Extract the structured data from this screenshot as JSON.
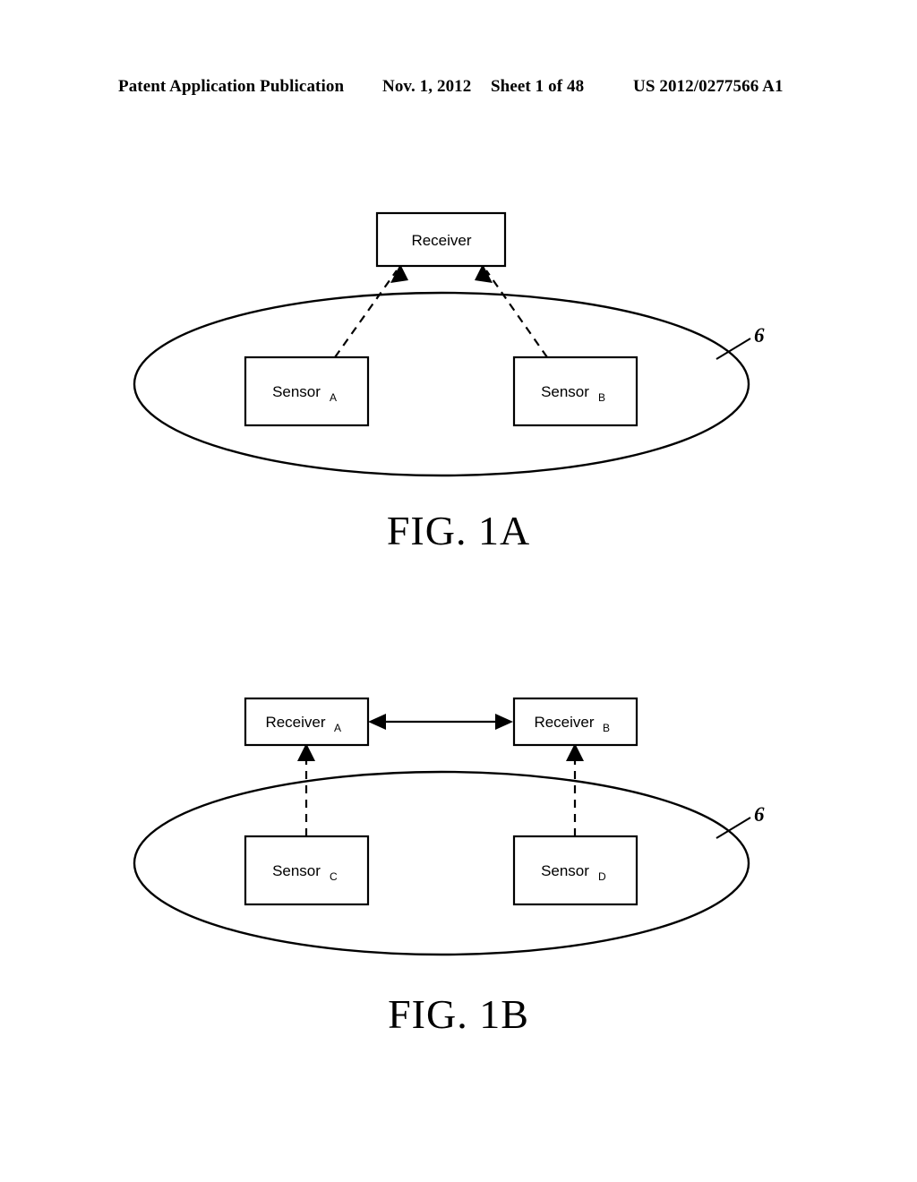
{
  "header": {
    "publication": "Patent Application Publication",
    "date": "Nov. 1, 2012",
    "sheet": "Sheet 1 of 48",
    "patent_number": "US 2012/0277566 A1"
  },
  "figures": [
    {
      "caption": "FIG. 1A",
      "reference_numeral": "6",
      "nodes": [
        {
          "label": "Receiver",
          "subscript": ""
        },
        {
          "label": "Sensor",
          "subscript": "A"
        },
        {
          "label": "Sensor",
          "subscript": "B"
        }
      ]
    },
    {
      "caption": "FIG. 1B",
      "reference_numeral": "6",
      "nodes": [
        {
          "label": "Receiver",
          "subscript": "A"
        },
        {
          "label": "Receiver",
          "subscript": "B"
        },
        {
          "label": "Sensor",
          "subscript": "C"
        },
        {
          "label": "Sensor",
          "subscript": "D"
        }
      ]
    }
  ],
  "colors": {
    "ink": "#000000",
    "page": "#ffffff"
  }
}
